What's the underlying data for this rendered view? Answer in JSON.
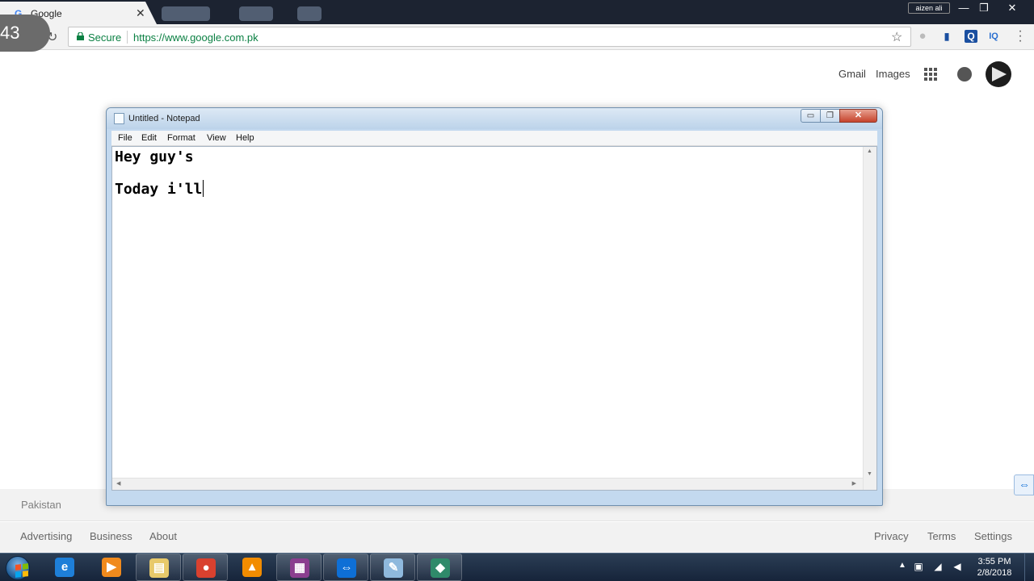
{
  "browser": {
    "tab_title": "Google",
    "tab_favicon": "G",
    "tab_close": "✕",
    "user_badge": "aizen ali",
    "window_buttons": {
      "minimize": "—",
      "restore": "❐",
      "close": "✕"
    },
    "overlay_counter": "43",
    "address": {
      "secure_label": "Secure",
      "url": "https://www.google.com.pk"
    },
    "extensions": [
      "IQ"
    ]
  },
  "google": {
    "header_links": {
      "gmail": "Gmail",
      "images": "Images"
    },
    "footer": {
      "country": "Pakistan",
      "left_links": [
        "Advertising",
        "Business",
        "About"
      ],
      "right_links": [
        "Privacy",
        "Terms",
        "Settings"
      ]
    }
  },
  "notepad": {
    "title": "Untitled - Notepad",
    "menu": [
      "File",
      "Edit",
      "Format",
      "View",
      "Help"
    ],
    "lines": [
      "Hey guy's",
      "Today i'll"
    ]
  },
  "taskbar": {
    "pinned": [
      {
        "name": "internet-explorer",
        "glyph": "e",
        "color": "#1e7fd8",
        "running": false
      },
      {
        "name": "media-player",
        "glyph": "▶",
        "color": "#f08a1d",
        "running": false
      },
      {
        "name": "file-explorer",
        "glyph": "▤",
        "color": "#e8c96a",
        "running": true
      },
      {
        "name": "chrome",
        "glyph": "●",
        "color": "#d9412f",
        "running": true
      },
      {
        "name": "vlc",
        "glyph": "▲",
        "color": "#f28c00",
        "running": false
      },
      {
        "name": "winrar",
        "glyph": "▦",
        "color": "#8b3e8f",
        "running": true
      },
      {
        "name": "teamviewer",
        "glyph": "⇔",
        "color": "#0e6fd6",
        "running": true
      },
      {
        "name": "notepad",
        "glyph": "✎",
        "color": "#8fb9dd",
        "running": true
      },
      {
        "name": "filmora",
        "glyph": "◆",
        "color": "#2f8a6a",
        "running": true
      }
    ],
    "clock": {
      "time": "3:55 PM",
      "date": "2/8/2018"
    }
  }
}
